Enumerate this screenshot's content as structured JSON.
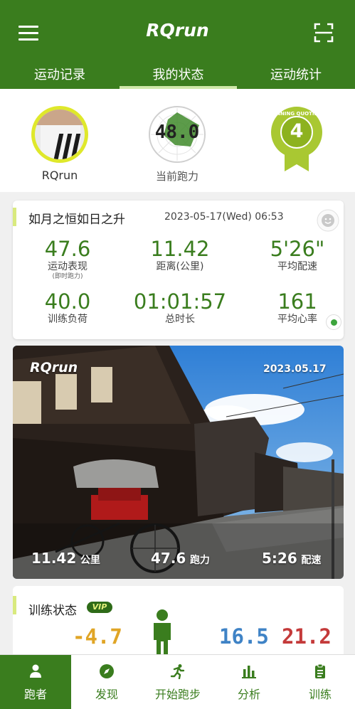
{
  "header": {
    "title": "RQrun",
    "menu_icon": "menu-icon",
    "scan_icon": "scan-icon",
    "color": "#3a7d1e"
  },
  "tabs": [
    {
      "label": "运动记录",
      "active": false
    },
    {
      "label": "我的状态",
      "active": true
    },
    {
      "label": "运动统计",
      "active": false
    }
  ],
  "profile": {
    "username": "RQrun",
    "current_ability_value": "48.0",
    "current_ability_label": "当前跑力",
    "rq_level": "4",
    "rq_badge_text": "RUNNING QUOTIENT"
  },
  "summary": {
    "title": "如月之恒如日之升",
    "date": "2023-05-17(Wed) 06:53",
    "stats": [
      {
        "value": "47.6",
        "label": "运动表现",
        "sub": "(即时跑力)"
      },
      {
        "value": "11.42",
        "label": "距离(公里)"
      },
      {
        "value": "5'26\"",
        "label": "平均配速"
      },
      {
        "value": "40.0",
        "label": "训练负荷"
      },
      {
        "value": "01:01:57",
        "label": "总时长"
      },
      {
        "value": "161",
        "label": "平均心率"
      }
    ]
  },
  "photo": {
    "brand": "RQrun",
    "date": "2023.05.17",
    "distance_value": "11.42",
    "distance_unit": "公里",
    "ability_value": "47.6",
    "ability_unit": "跑力",
    "pace_value": "5:26",
    "pace_unit": "配速"
  },
  "training_status": {
    "title": "训练状态",
    "vip": "VIP",
    "values": [
      {
        "value": "-4.7",
        "color": "#e0a526"
      },
      {
        "value": "16.5",
        "color": "#3f83c6"
      },
      {
        "value": "21.2",
        "color": "#c43a3a"
      }
    ]
  },
  "bottom_nav": [
    {
      "label": "跑者",
      "icon": "person-icon",
      "active": true
    },
    {
      "label": "发现",
      "icon": "compass-icon",
      "active": false
    },
    {
      "label": "开始跑步",
      "icon": "runner-icon",
      "active": false
    },
    {
      "label": "分析",
      "icon": "bar-chart-icon",
      "active": false
    },
    {
      "label": "训练",
      "icon": "clipboard-icon",
      "active": false
    }
  ]
}
